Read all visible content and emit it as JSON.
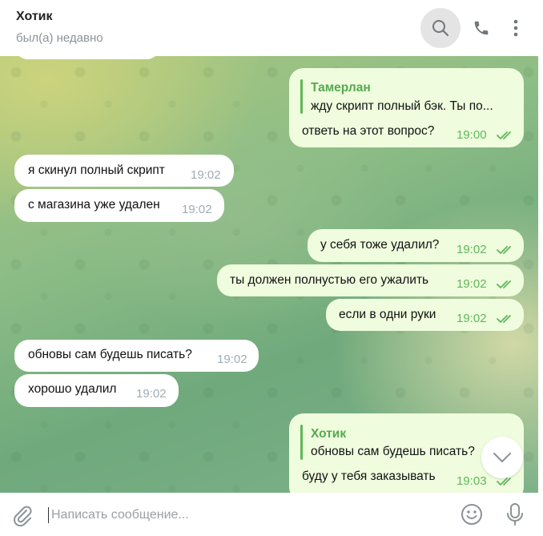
{
  "header": {
    "name": "Хотик",
    "status": "был(а) недавно",
    "icons": [
      "search-icon",
      "phone-icon",
      "more-vertical-icon"
    ]
  },
  "messages": [
    {
      "dir": "out",
      "reply_to": {
        "name": "Тамерлан",
        "text": "жду скрипт полный бэк. Ты по..."
      },
      "text": "ответь на этот вопрос?",
      "time": "19:00",
      "read": true
    },
    {
      "dir": "in",
      "text": "я скинул полный скрипт",
      "time": "19:02"
    },
    {
      "dir": "in",
      "text": "с магазина уже удален",
      "time": "19:02"
    },
    {
      "dir": "out",
      "text": "у себя тоже удалил?",
      "time": "19:02",
      "read": true
    },
    {
      "dir": "out",
      "text": "ты должен полнустью его ужалить",
      "time": "19:02",
      "read": true
    },
    {
      "dir": "out",
      "text": "если в одни руки",
      "time": "19:02",
      "read": true
    },
    {
      "dir": "in",
      "text": "обновы сам будешь писать?",
      "time": "19:02"
    },
    {
      "dir": "in",
      "text": "хорошо удалил",
      "time": "19:02"
    },
    {
      "dir": "out",
      "reply_to": {
        "name": "Хотик",
        "text": "обновы сам будешь писать?"
      },
      "text": "буду у тебя заказывать",
      "time": "19:03",
      "read": true
    }
  ],
  "composer": {
    "placeholder": "Написать сообщение..."
  },
  "colors": {
    "outgoing_bubble": "#effdde",
    "incoming_bubble": "#ffffff",
    "accent_green": "#5fb75a"
  }
}
